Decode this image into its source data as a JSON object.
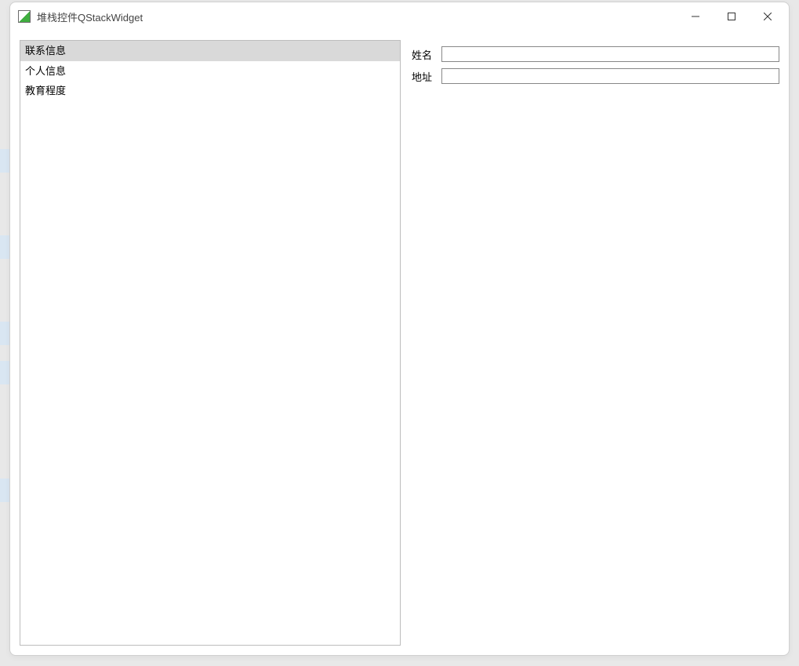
{
  "window": {
    "title": "堆栈控件QStackWidget"
  },
  "list": {
    "items": [
      {
        "label": "联系信息",
        "selected": true
      },
      {
        "label": "个人信息",
        "selected": false
      },
      {
        "label": "教育程度",
        "selected": false
      }
    ]
  },
  "form": {
    "rows": [
      {
        "label": "姓名",
        "value": ""
      },
      {
        "label": "地址",
        "value": ""
      }
    ]
  }
}
